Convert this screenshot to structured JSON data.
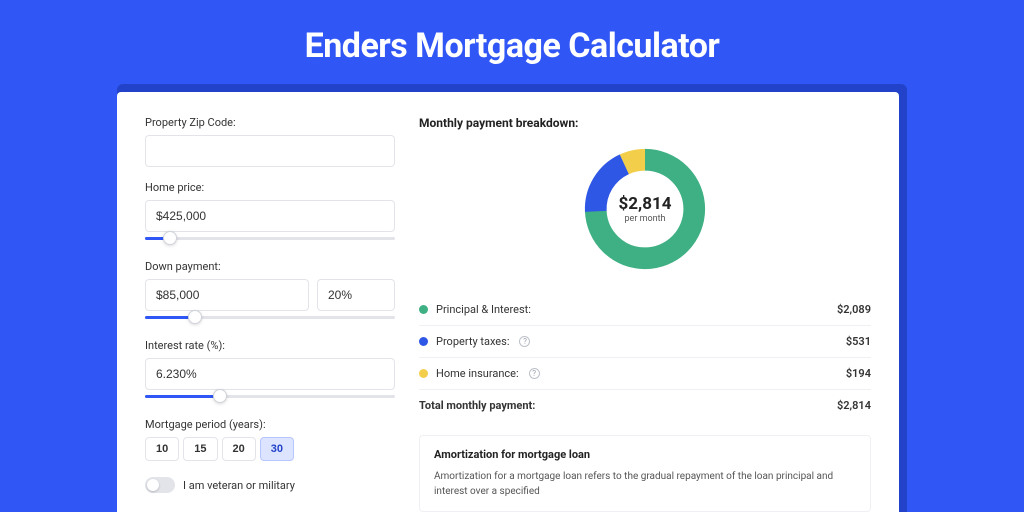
{
  "title": "Enders Mortgage Calculator",
  "form": {
    "zip_label": "Property Zip Code:",
    "zip_value": "",
    "home_price_label": "Home price:",
    "home_price_value": "$425,000",
    "home_price_pct": 10,
    "down_payment_label": "Down payment:",
    "down_payment_value": "$85,000",
    "down_payment_pct_value": "20%",
    "down_payment_slider_pct": 20,
    "interest_label": "Interest rate (%):",
    "interest_value": "6.230%",
    "interest_slider_pct": 30,
    "period_label": "Mortgage period (years):",
    "periods": [
      "10",
      "15",
      "20",
      "30"
    ],
    "period_selected": "30",
    "veteran_label": "I am veteran or military",
    "veteran_on": false
  },
  "breakdown": {
    "title": "Monthly payment breakdown:",
    "center_amount": "$2,814",
    "center_sub": "per month",
    "items": [
      {
        "label": "Principal & Interest:",
        "value": "$2,089",
        "color": "#3fb084",
        "help": false
      },
      {
        "label": "Property taxes:",
        "value": "$531",
        "color": "#2f57e6",
        "help": true
      },
      {
        "label": "Home insurance:",
        "value": "$194",
        "color": "#f2ce4a",
        "help": true
      }
    ],
    "total_label": "Total monthly payment:",
    "total_value": "$2,814"
  },
  "chart_data": {
    "type": "pie",
    "title": "Monthly payment breakdown",
    "series": [
      {
        "name": "Principal & Interest",
        "value": 2089,
        "color": "#3fb084"
      },
      {
        "name": "Property taxes",
        "value": 531,
        "color": "#2f57e6"
      },
      {
        "name": "Home insurance",
        "value": 194,
        "color": "#f2ce4a"
      }
    ],
    "total": 2814,
    "center_label": "$2,814 per month"
  },
  "amort": {
    "title": "Amortization for mortgage loan",
    "text": "Amortization for a mortgage loan refers to the gradual repayment of the loan principal and interest over a specified"
  },
  "colors": {
    "brand": "#3056f5"
  }
}
